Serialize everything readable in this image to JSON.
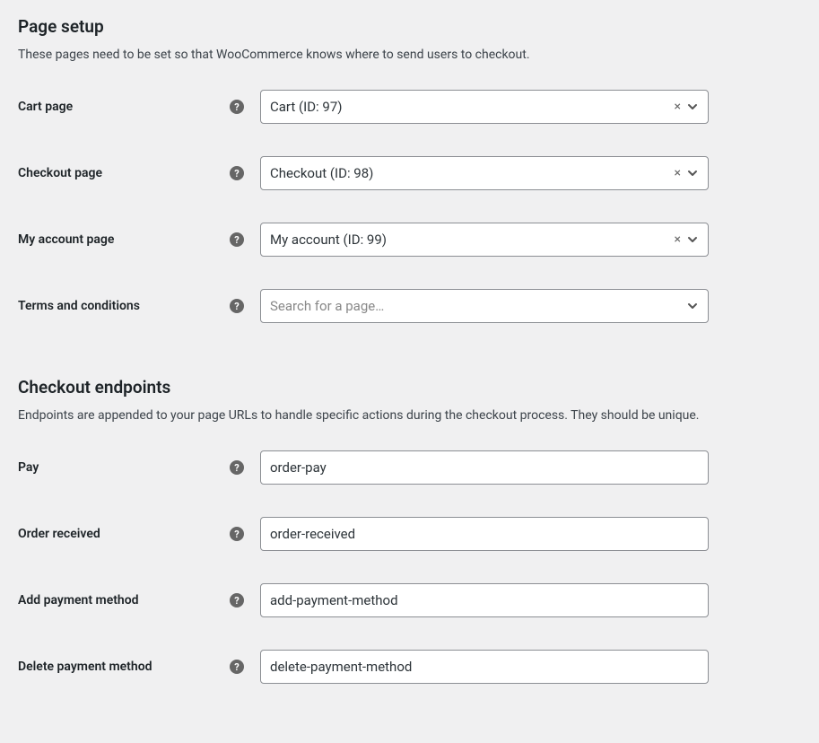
{
  "page_setup": {
    "heading": "Page setup",
    "description": "These pages need to be set so that WooCommerce knows where to send users to checkout.",
    "fields": {
      "cart": {
        "label": "Cart page",
        "value": "Cart (ID: 97)"
      },
      "checkout": {
        "label": "Checkout page",
        "value": "Checkout (ID: 98)"
      },
      "my_account": {
        "label": "My account page",
        "value": "My account (ID: 99)"
      },
      "terms": {
        "label": "Terms and conditions",
        "placeholder": "Search for a page…"
      }
    }
  },
  "checkout_endpoints": {
    "heading": "Checkout endpoints",
    "description": "Endpoints are appended to your page URLs to handle specific actions during the checkout process. They should be unique.",
    "fields": {
      "pay": {
        "label": "Pay",
        "value": "order-pay"
      },
      "order_received": {
        "label": "Order received",
        "value": "order-received"
      },
      "add_payment": {
        "label": "Add payment method",
        "value": "add-payment-method"
      },
      "delete_payment": {
        "label": "Delete payment method",
        "value": "delete-payment-method"
      }
    }
  },
  "help_tooltip": "?"
}
